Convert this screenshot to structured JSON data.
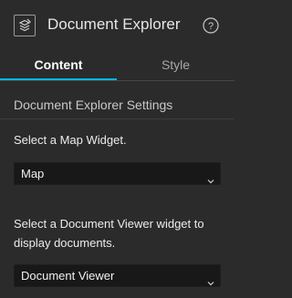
{
  "header": {
    "icon": "widget-box-icon",
    "title": "Document Explorer",
    "help_icon": "question-circle-icon"
  },
  "tabs": [
    {
      "label": "Content",
      "active": true
    },
    {
      "label": "Style",
      "active": false
    }
  ],
  "settings": {
    "section_title": "Document Explorer Settings",
    "map_widget": {
      "label": "Select a Map Widget.",
      "selected": "Map"
    },
    "viewer_widget": {
      "label": "Select a Document Viewer widget to display documents.",
      "selected": "Document Viewer"
    }
  },
  "colors": {
    "background": "#2b2b2b",
    "accent": "#00b5e2",
    "select_bg": "#181818"
  }
}
